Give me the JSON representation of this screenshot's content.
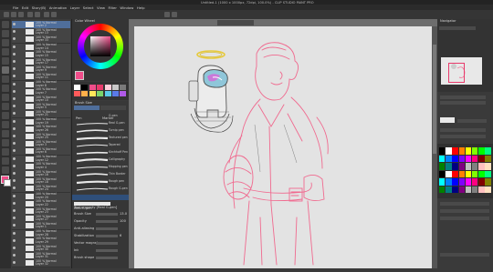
{
  "app": {
    "title": "Untitled-1 (1000 x 1000px, 72dpi, 100.0%) - CLIP STUDIO PAINT PRO"
  },
  "menu": [
    "File",
    "Edit",
    "Story(B)",
    "Animation",
    "Layer",
    "Select",
    "View",
    "Filter",
    "Window",
    "Help"
  ],
  "canvas_tab": "Illustration*",
  "layers": {
    "rows": [
      {
        "mode": "100 % Normal",
        "name": "Layer 2"
      },
      {
        "mode": "100 % Normal",
        "name": "Layer 13"
      },
      {
        "mode": "100 % Normal",
        "name": "Layer 33"
      },
      {
        "mode": "100 % Normal",
        "name": "Layer 14"
      },
      {
        "mode": "100 % Normal",
        "name": "Layer 15"
      },
      {
        "mode": "100 % Normal",
        "name": "Layer 17"
      },
      {
        "mode": "100 % Normal",
        "name": "Layer 9"
      },
      {
        "mode": "100 % Normal",
        "name": "Layer 11"
      },
      {
        "mode": "100 % Normal",
        "name": "Layer 8"
      },
      {
        "mode": "100 % Normal",
        "name": "Layer 7"
      },
      {
        "mode": "100 % Normal",
        "name": "Layer 10"
      },
      {
        "mode": "100 % Normal",
        "name": "Layer 5"
      },
      {
        "mode": "100 % Normal",
        "name": "Layer 21"
      },
      {
        "mode": "100 % Normal",
        "name": "Layer 19"
      },
      {
        "mode": "100 % Normal",
        "name": "Layer 26"
      },
      {
        "mode": "100 % Normal",
        "name": "Layer 25"
      },
      {
        "mode": "100 % Normal",
        "name": "Layer 3"
      },
      {
        "mode": "100 % Normal",
        "name": "Layer 6"
      },
      {
        "mode": "100 % Normal",
        "name": "Layer 12"
      },
      {
        "mode": "100 % Normal",
        "name": "Layer 4"
      },
      {
        "mode": "100 % Normal",
        "name": "Layer 16"
      },
      {
        "mode": "100 % Normal",
        "name": "Layer 18"
      },
      {
        "mode": "100 % Normal",
        "name": "Layer 24"
      },
      {
        "mode": "100 % Normal",
        "name": "Layer 20"
      },
      {
        "mode": "100 % Normal",
        "name": "Layer 22"
      },
      {
        "mode": "100 % Normal",
        "name": "Layer 23"
      },
      {
        "mode": "100 % Normal",
        "name": "Layer 27"
      },
      {
        "mode": "100 % Normal",
        "name": "Layer 1"
      },
      {
        "mode": "100 % Normal",
        "name": "Layer 28"
      },
      {
        "mode": "100 % Normal",
        "name": "Layer 29"
      },
      {
        "mode": "100 % Normal",
        "name": "Layer 30"
      },
      {
        "mode": "100 % Normal",
        "name": "Layer 31"
      },
      {
        "mode": "100 % Normal",
        "name": "Layer 32"
      }
    ]
  },
  "color_panel": {
    "title": "Color Wheel",
    "main_color": "#f04d8a"
  },
  "brush_panel": {
    "title": "Brush Size",
    "tabs": [
      "Pen",
      "Marker"
    ],
    "brushes": [
      "G-pen",
      "Real G-pen",
      "Turnip pen",
      "Textured pen",
      "Tapered",
      "Kirchhoff Pen",
      "Calligraphy",
      "Mapping pen",
      "Thin Border",
      "Rough pen",
      "Rough G-pen"
    ]
  },
  "tool_property": {
    "title": "Tool property [Real G-pen]",
    "brush_name": "Real G-pen",
    "rows": [
      "Brush Size",
      "Opacity",
      "Anti-aliasing",
      "Stabilization",
      "Vector magnet",
      "Ink",
      "Brush shape"
    ],
    "values": [
      "13.0",
      "100",
      "",
      "6",
      "",
      "",
      ""
    ]
  },
  "navigator": {
    "title": "Navigator",
    "zoom": "100.0",
    "angle": "0.0"
  },
  "colors": {
    "accent": "#e83a6b",
    "sketch": "#f06a8f",
    "halo": "#e6c93a"
  }
}
